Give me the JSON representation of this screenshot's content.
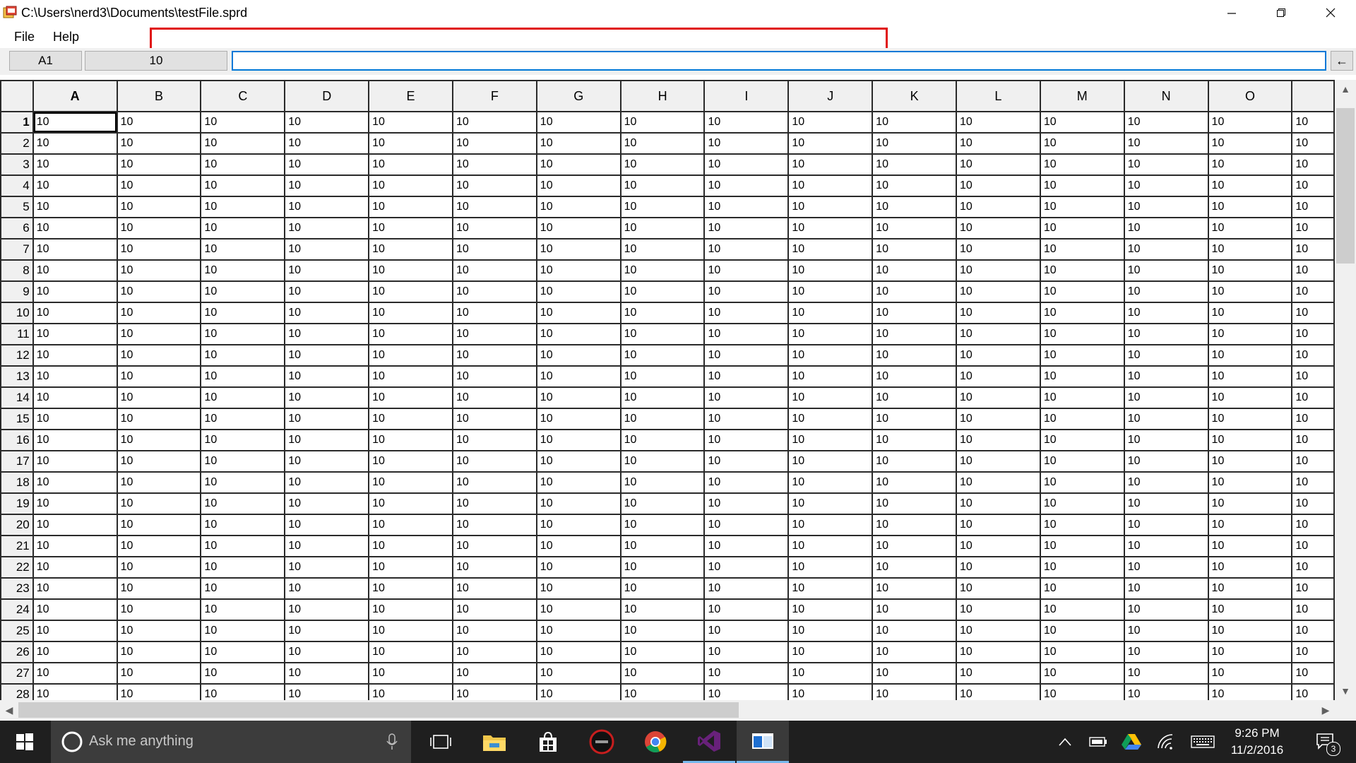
{
  "window": {
    "title": "C:\\Users\\nerd3\\Documents\\testFile.sprd"
  },
  "menu": {
    "items": [
      {
        "label": "File"
      },
      {
        "label": "Help"
      }
    ]
  },
  "formula_bar": {
    "cell_ref": "A1",
    "cell_value": "10",
    "input_value": "",
    "enter_label": "←"
  },
  "grid": {
    "columns": [
      "A",
      "B",
      "C",
      "D",
      "E",
      "F",
      "G",
      "H",
      "I",
      "J",
      "K",
      "L",
      "M",
      "N",
      "O"
    ],
    "partial_column_value": "10",
    "row_count": 28,
    "cell_value": "10",
    "selected_cell": "A1"
  },
  "taskbar": {
    "search_placeholder": "Ask me anything",
    "time": "9:26 PM",
    "date": "11/2/2016",
    "notification_count": "3",
    "apps": [
      "task-view",
      "file-explorer",
      "store",
      "asus-app",
      "chrome",
      "visual-studio",
      "spreadsheet-app"
    ],
    "accent_color": "#76b9ed"
  },
  "colors": {
    "highlight_box": "#e01010",
    "input_border": "#0078d7"
  }
}
